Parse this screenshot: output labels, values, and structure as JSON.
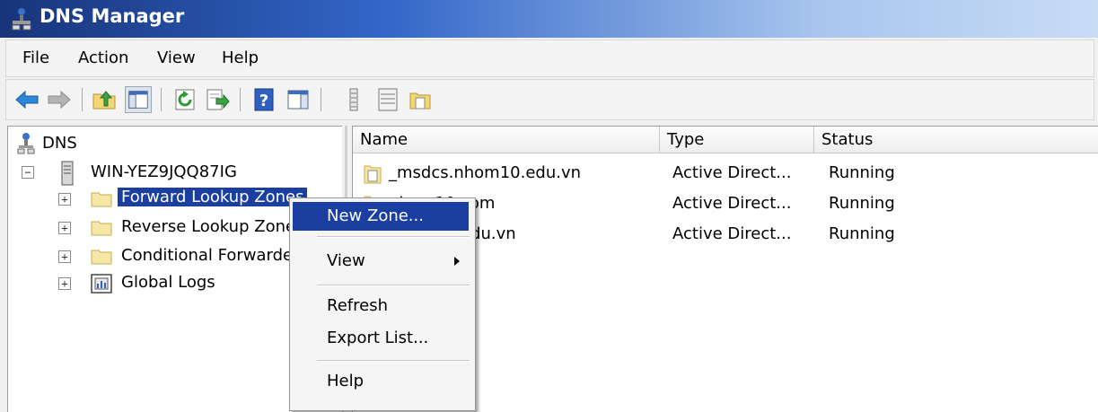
{
  "window": {
    "title": "DNS Manager"
  },
  "menu": [
    "File",
    "Action",
    "View",
    "Help"
  ],
  "toolbar": {
    "buttons": [
      "back-arrow-icon",
      "forward-arrow-icon",
      "up-folder-icon",
      "show-hide-console-tree-icon",
      "refresh-icon",
      "export-list-icon",
      "help-icon",
      "show-hide-action-pane-icon",
      "list-view-icon",
      "detail-view-icon",
      "properties-icon"
    ]
  },
  "tree": {
    "root": "DNS",
    "server": "WIN-YEZ9JQQ87IG",
    "items": [
      {
        "label": "Forward Lookup Zones",
        "selected": true
      },
      {
        "label": "Reverse Lookup Zones",
        "selected": false
      },
      {
        "label": "Conditional Forwarders",
        "selected": false
      },
      {
        "label": "Global Logs",
        "selected": false
      }
    ]
  },
  "list": {
    "columns": [
      "Name",
      "Type",
      "Status"
    ],
    "rows": [
      {
        "name": "_msdcs.nhom10.edu.vn",
        "type": "Active Direct...",
        "status": "Running"
      },
      {
        "name": "nhom10.com",
        "type": "Active Direct...",
        "status": "Running"
      },
      {
        "name": "nhom10.edu.vn",
        "type": "Active Direct...",
        "status": "Running"
      }
    ]
  },
  "context_menu": {
    "items": [
      "New Zone...",
      "View",
      "Refresh",
      "Export List...",
      "Help"
    ],
    "highlighted": "New Zone..."
  },
  "colors": {
    "selection": "#1b3fa0",
    "title_bar_start": "#17347a"
  }
}
